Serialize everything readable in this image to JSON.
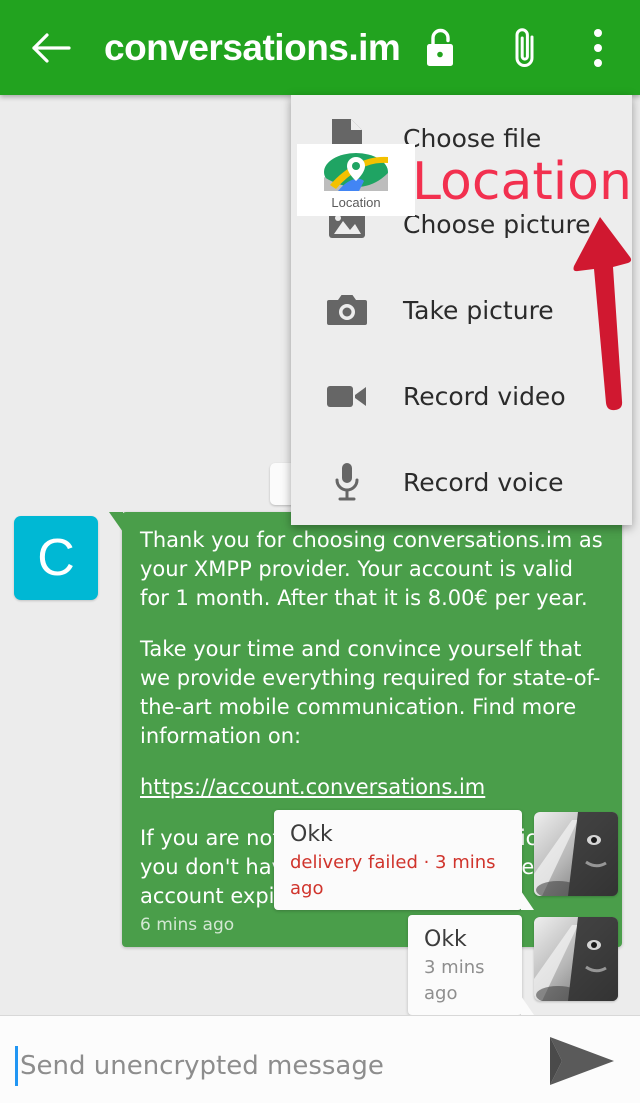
{
  "app": {
    "header": {
      "title": "conversations.im",
      "back_icon": "arrow-left-icon",
      "lock_icon": "unlocked-padlock-icon",
      "attach_icon": "paperclip-icon",
      "overflow_icon": "three-dots-vertical-icon",
      "background_color": "#22a31f"
    }
  },
  "attachment_menu": {
    "items": [
      {
        "label": "Choose file",
        "icon": "document-file-icon"
      },
      {
        "label": "Choose picture",
        "icon": "image-picture-icon"
      },
      {
        "label": "Take picture",
        "icon": "camera-icon"
      },
      {
        "label": "Record video",
        "icon": "video-camera-icon"
      },
      {
        "label": "Record voice",
        "icon": "microphone-icon"
      }
    ],
    "background_color": "#ededed"
  },
  "location_overlay": {
    "label": "Location",
    "icon": "google-maps-location-pin-icon"
  },
  "annotation": {
    "text": "Location",
    "color": "#f2304f",
    "arrow_icon": "red-up-arrow-icon",
    "arrow_color": "#d01830"
  },
  "conversation": {
    "incoming": {
      "avatar_letter": "C",
      "avatar_color": "#00b8d4",
      "bubble_color": "#4a9e4a",
      "paragraphs": [
        "Thank you for choosing conversations.im as your XMPP provider. Your account is valid for 1 month. After that it is 8.00€ per year.",
        "Take your time and convince yourself that we provide everything required for state-of-the-art mobile communication. Find more information on:"
      ],
      "link": "https://account.conversations.im",
      "closing_paragraph": "If you are not satisfied with our services, you don't have to do anything. Just let your account expire automatically.",
      "time": "6 mins ago"
    },
    "outgoing": [
      {
        "text": "Okk",
        "meta": "delivery failed · 3 mins ago",
        "failed": true,
        "avatar": "user-photo-avatar"
      },
      {
        "text": "Okk",
        "meta": "3 mins ago",
        "failed": false,
        "avatar": "user-photo-avatar"
      }
    ]
  },
  "composer": {
    "placeholder": "Send unencrypted message",
    "send_icon": "send-paper-plane-icon"
  }
}
